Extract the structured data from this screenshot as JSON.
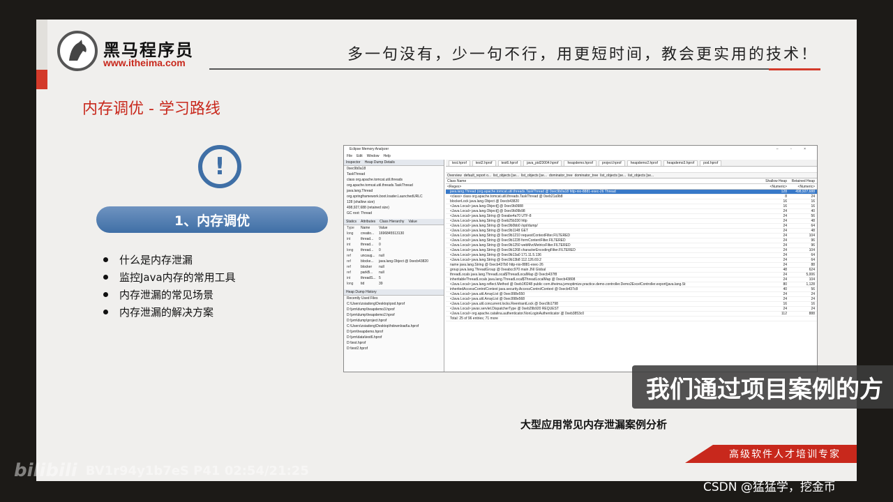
{
  "header": {
    "logo_name": "黑马程序员",
    "logo_url": "www.itheima.com",
    "slogan": "多一句没有，少一句不行，用更短时间，教会更实用的技术！"
  },
  "section": {
    "title": "内存调优 - 学习路线",
    "pill_label": "1、内存调优",
    "alert_glyph": "!",
    "bullets": [
      "什么是内存泄漏",
      "监控Java内存的常用工具",
      "内存泄漏的常见场景",
      "内存泄漏的解决方案"
    ],
    "caption": "大型应用常见内存泄漏案例分析",
    "tagline": "高级软件人才培训专家"
  },
  "mat": {
    "window_title": "Eclipse Memory Analyzer",
    "menu": [
      "File",
      "Edit",
      "Window",
      "Help"
    ],
    "inspector_tab": "Inspector",
    "heap_details_tab": "Heap Dump Details",
    "inspector_rows": [
      "0xec9b0a18",
      "TaskThread",
      "class org.apache.tomcat.util.threads",
      "org.apache.tomcat.util.threads.TaskThread",
      "java.lang.Thread",
      "org.springframework.boot.loader.LaunchedURLC",
      "128 (shallow size)",
      "498,927,688 (retained size)",
      "GC root: Thread"
    ],
    "attr_tabs": [
      "Statics",
      "Attributes",
      "Class Hierarchy",
      "Value"
    ],
    "attr_header": [
      "Type",
      "Name",
      "Value"
    ],
    "attr_rows": [
      [
        "long",
        "creatio...",
        "1696845513130"
      ],
      [
        "int",
        "thread...",
        "0"
      ],
      [
        "int",
        "thread...",
        "0"
      ],
      [
        "long",
        "thread...",
        "0"
      ],
      [
        "ref",
        "uncaug...",
        "null"
      ],
      [
        "ref",
        "blocke...",
        "java.lang.Object @ 0xecb43820"
      ],
      [
        "ref",
        "blocker",
        "null"
      ],
      [
        "ref",
        "parkB...",
        "null"
      ],
      [
        "int",
        "threadS...",
        "5"
      ],
      [
        "long",
        "tid",
        "39"
      ]
    ],
    "history_tab": "Heap Dump History",
    "history_label": "Recently Used Files",
    "history_rows": [
      "C:\\Users\\zsiadong\\Desktop\\pod.hprof",
      "D:\\jvm\\dump\\heapdemo3.hprof",
      "D:\\jvm\\dump\\heapdemo2.hprof",
      "D:\\jvm\\dump\\project.hprof",
      "C:\\Users\\zsiadong\\Desktop\\hdownload\\a.hprof",
      "D:\\jvm\\heapdemo.hprof",
      "D:\\jvm\\data\\test6.hprof",
      "D:\\test.hprof",
      "D:\\test2.hprof"
    ],
    "file_tabs": [
      "test.hprof",
      "test2.hprof",
      "test6.hprof",
      "java_pid23004.hprof",
      "heapdemo.hprof",
      "project.hprof",
      "heapdemo2.hprof",
      "heapdemo3.hprof",
      "pod.hprof"
    ],
    "sub_tabs": [
      "Overview",
      "default_report o...",
      "list_objects [se...",
      "list_objects [se...",
      "dominator_tree",
      "dominator_tree",
      "list_objects [se...",
      "list_objects [se..."
    ],
    "grid_header": [
      "Class Name",
      "Shallow Heap",
      "Retained Heap"
    ],
    "grid_filter": [
      "<Regex>",
      "<Numeric>",
      "<Numeric>"
    ],
    "grid_rows": [
      [
        "java.lang.Thread (org.apache.tomcat.util.threads.TaskThread @ 0xec9b0a18 http-nio-8881-exec-26 Thread",
        "128",
        "498,927,688"
      ],
      [
        "<class> class org.apache.tomcat.util.threads.TaskThread @ 0xeb21a9b8",
        "8",
        "24"
      ],
      [
        "blockerLock java.lang.Object @ 0xecb43820",
        "16",
        "16"
      ],
      [
        "<Java Local> java.lang.Object[] @ 0xec9b0988",
        "16",
        "16"
      ],
      [
        "<Java Local> java.lang.Object[] @ 0xec9b09b98",
        "24",
        "40"
      ],
      [
        "<Java Local> java.lang.String @ 0xeabe4a70 UTF-8",
        "24",
        "56"
      ],
      [
        "<Java Local> java.lang.String @ 0xeb25b330 http",
        "24",
        "48"
      ],
      [
        "<Java Local> java.lang.String @ 0xec9b0bb0 /opt/dump/",
        "24",
        "64"
      ],
      [
        "<Java Local> java.lang.String @ 0xec9b1148 GET",
        "24",
        "48"
      ],
      [
        "<Java Local> java.lang.String @ 0xec9b1210 requestContextFilter.FILTERED",
        "24",
        "104"
      ],
      [
        "<Java Local> java.lang.String @ 0xec9b1228 formContentFilter.FILTERED",
        "24",
        "96"
      ],
      [
        "<Java Local> java.lang.String @ 0xec9b1250 webMvcMetricsFilter.FILTERED",
        "24",
        "96"
      ],
      [
        "<Java Local> java.lang.String @ 0xec9b1268 characterEncodingFilter.FILTERED",
        "24",
        "104"
      ],
      [
        "<Java Local> java.lang.String @ 0xec9b13a0 171.11.5.136",
        "24",
        "64"
      ],
      [
        "<Java Local> java.lang.String @ 0xec9b13b8 112.126.69.2",
        "24",
        "64"
      ],
      [
        "name java.lang.String @ 0xecb437b0 http-nio-8881-exec-26",
        "24",
        "88"
      ],
      [
        "group java.lang.ThreadGroup @ 0xeabcc970 main JNI Global",
        "48",
        "624"
      ],
      [
        "threadLocals java.lang.ThreadLocal$ThreadLocalMap @ 0xecb437f8",
        "24",
        "5,006"
      ],
      [
        "inheritableThreadLocals java.lang.ThreadLocal$ThreadLocalMap @ 0xecb43808",
        "24",
        "104"
      ],
      [
        "<Java Local> java.lang.reflect.Method @ 0xeb1f0248 public com.itheima.jvmoptimize.practice.demo.controller.Demo2ExcelController.export(java.lang.St",
        "80",
        "1,128"
      ],
      [
        "inheritedAccessControlContext java.security.AccessControlContext @ 0xecb437c8",
        "40",
        "56"
      ],
      [
        "<Java Local> java.util.ArrayList @ 0xec998e550",
        "24",
        "24"
      ],
      [
        "<Java Local> java.util.ArrayList @ 0xec998e568",
        "24",
        "24"
      ],
      [
        "<Java Local> java.util.concurrent.locks.ReentrantLock @ 0xec9b1798",
        "16",
        "16"
      ],
      [
        "<Java Local> javax.servlet.DispatcherType @ 0xeb29b920 REQUEST",
        "24",
        "24"
      ],
      [
        "<Java Local> org.apache.catalina.authenticator.NonLoginAuthenticator @ 0xeb3853c0",
        "112",
        "888"
      ],
      [
        "Total: 25 of 96 entries; 71 more",
        "",
        ""
      ]
    ]
  },
  "overlay": {
    "subtitle": "我们通过项目案例的方",
    "bili_logo": "bilibili",
    "bili_info": "BV1r94y1b7eS P41 02:54/21:25",
    "csdn": "CSDN @猛猛学，挖金币"
  },
  "colors": {
    "accent_red": "#c8281c",
    "accent_blue": "#3f6fa6",
    "selection_blue": "#3778c8"
  }
}
